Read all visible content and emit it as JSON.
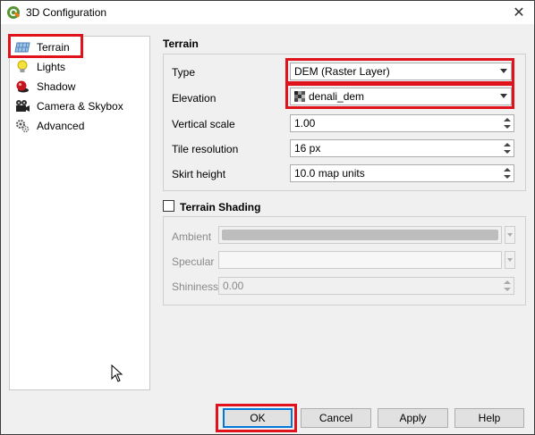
{
  "window": {
    "title": "3D Configuration",
    "close_symbol": "✕"
  },
  "sidebar": {
    "items": [
      {
        "label": "Terrain",
        "icon": "terrain-icon"
      },
      {
        "label": "Lights",
        "icon": "lightbulb-icon"
      },
      {
        "label": "Shadow",
        "icon": "shadow-sphere-icon"
      },
      {
        "label": "Camera & Skybox",
        "icon": "camera-icon"
      },
      {
        "label": "Advanced",
        "icon": "gears-icon"
      }
    ]
  },
  "terrain": {
    "section_title": "Terrain",
    "type_label": "Type",
    "type_value": "DEM (Raster Layer)",
    "elevation_label": "Elevation",
    "elevation_value": "denali_dem",
    "vertical_scale_label": "Vertical scale",
    "vertical_scale_value": "1.00",
    "tile_resolution_label": "Tile resolution",
    "tile_resolution_value": "16 px",
    "skirt_height_label": "Skirt height",
    "skirt_height_value": "10.0 map units"
  },
  "shading": {
    "section_title": "Terrain Shading",
    "checked": false,
    "ambient_label": "Ambient",
    "specular_label": "Specular",
    "shininess_label": "Shininess",
    "shininess_value": "0.00"
  },
  "buttons": {
    "ok": "OK",
    "cancel": "Cancel",
    "apply": "Apply",
    "help": "Help"
  },
  "colors": {
    "highlight": "#e0121b",
    "ambient_swatch": "#bdbdbd"
  }
}
